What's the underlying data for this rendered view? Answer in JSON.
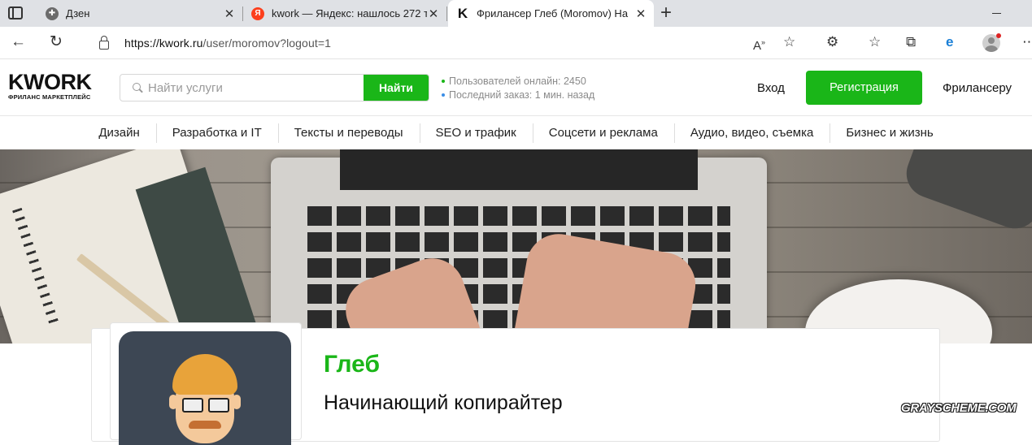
{
  "browser": {
    "tabs": [
      {
        "title": "Дзен",
        "favicon": "dzen-icon",
        "favicon_color": "#6b6b6b"
      },
      {
        "title": "kwork — Яндекс: нашлось 272 т",
        "favicon": "yandex-icon",
        "favicon_color": "#fc3f1d",
        "favicon_letter": "Я"
      },
      {
        "title": "Фрилансер Глеб (Moromov) На",
        "favicon": "kwork-icon",
        "favicon_color": "#111111",
        "favicon_letter": "K",
        "active": true
      }
    ],
    "url_host": "https://kwork.ru",
    "url_path": "/user/moromov?logout=1"
  },
  "site": {
    "logo_word": "KWORK",
    "logo_tagline": "ФРИЛАНС МАРКЕТПЛЕЙС",
    "search_placeholder": "Найти услуги",
    "search_button": "Найти",
    "stats": {
      "online_label": "Пользователей онлайн:",
      "online_value": "2450",
      "last_order_label": "Последний заказ:",
      "last_order_value": "1 мин. назад"
    },
    "login": "Вход",
    "register": "Регистрация",
    "freelancer": "Фрилансеру",
    "categories": [
      "Дизайн",
      "Разработка и IT",
      "Тексты и переводы",
      "SEO и трафик",
      "Соцсети и реклама",
      "Аудио, видео, съемка",
      "Бизнес и жизнь"
    ]
  },
  "profile": {
    "name": "Глеб",
    "title": "Начинающий копирайтер"
  },
  "watermark": "GRAYSCHEME.COM",
  "colors": {
    "brand_green": "#1ab618",
    "stat_dot_green": "#1ab618",
    "stat_dot_blue": "#3b8ee6"
  }
}
